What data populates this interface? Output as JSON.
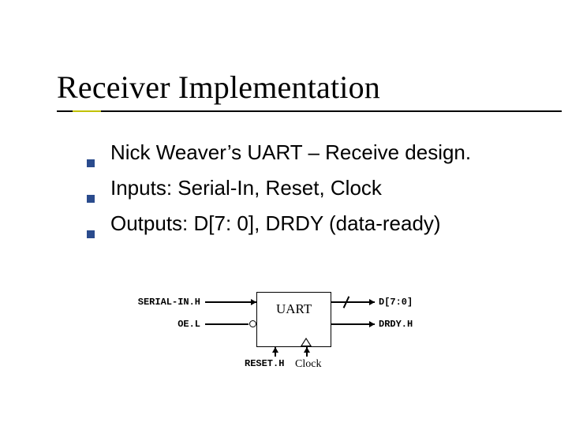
{
  "title": "Receiver Implementation",
  "bullets": [
    "Nick Weaver’s UART – Receive design.",
    "Inputs: Serial-In, Reset, Clock",
    "Outputs: D[7: 0], DRDY (data-ready)"
  ],
  "diagram": {
    "block_label": "UART",
    "serial_in": "SERIAL-IN.H",
    "oe": "OE.L",
    "d_out": "D[7:0]",
    "drdy": "DRDY.H",
    "reset": "RESET.H",
    "clock": "Clock"
  }
}
